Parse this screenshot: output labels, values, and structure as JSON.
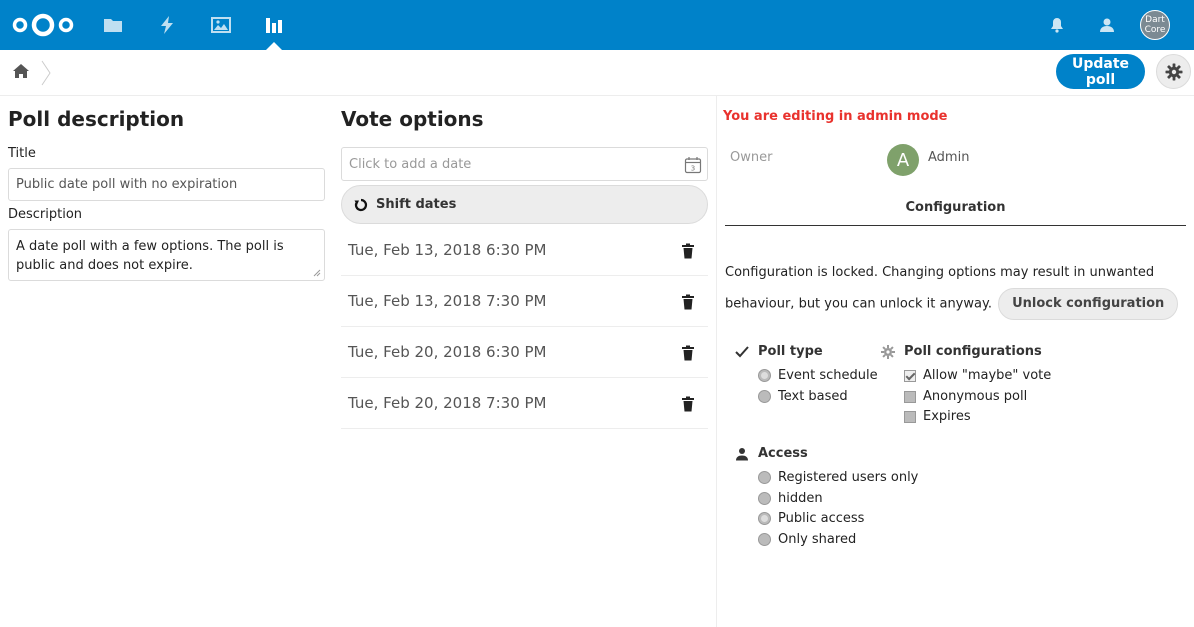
{
  "header": {
    "apps": [
      {
        "name": "files",
        "icon": "folder-icon"
      },
      {
        "name": "activity",
        "icon": "lightning-icon"
      },
      {
        "name": "gallery",
        "icon": "image-icon"
      },
      {
        "name": "polls",
        "icon": "poll-icon",
        "active": true
      }
    ],
    "avatar_text_line1": "Dart",
    "avatar_text_line2": "Core"
  },
  "toolbar": {
    "update_label": "Update poll"
  },
  "description": {
    "heading": "Poll description",
    "title_label": "Title",
    "title_value": "Public date poll with no expiration",
    "description_label": "Description",
    "description_value": "A date poll with a few options. The poll is public and does not expire."
  },
  "vote_options": {
    "heading": "Vote options",
    "date_placeholder": "Click to add a date",
    "calendar_day": "3",
    "shift_label": "Shift dates",
    "options": [
      "Tue, Feb 13, 2018 6:30 PM",
      "Tue, Feb 13, 2018 7:30 PM",
      "Tue, Feb 20, 2018 6:30 PM",
      "Tue, Feb 20, 2018 7:30 PM"
    ]
  },
  "sidebar": {
    "admin_warning": "You are editing in admin mode",
    "owner_label": "Owner",
    "owner_initial": "A",
    "owner_name": "Admin",
    "tab_label": "Configuration",
    "locked_text": "Configuration is locked. Changing options may result in unwanted behaviour, but you can unlock it anyway.",
    "unlock_label": "Unlock configuration",
    "poll_type": {
      "title": "Poll type",
      "options": [
        {
          "label": "Event schedule",
          "selected": true
        },
        {
          "label": "Text based",
          "selected": false
        }
      ]
    },
    "poll_config": {
      "title": "Poll configurations",
      "options": [
        {
          "label": "Allow \"maybe\" vote",
          "checked": true
        },
        {
          "label": "Anonymous poll",
          "checked": false
        },
        {
          "label": "Expires",
          "checked": false
        }
      ]
    },
    "access": {
      "title": "Access",
      "options": [
        {
          "label": "Registered users only",
          "selected": false
        },
        {
          "label": "hidden",
          "selected": false
        },
        {
          "label": "Public access",
          "selected": true
        },
        {
          "label": "Only shared",
          "selected": false
        }
      ]
    }
  },
  "colors": {
    "brand": "#0082c9",
    "warning": "#e9322d",
    "owner_avatar": "#7fa16b"
  }
}
